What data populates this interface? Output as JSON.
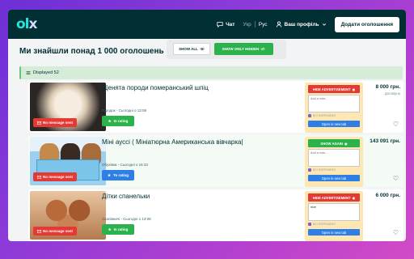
{
  "header": {
    "logo": "olx",
    "chat_label": "Чат",
    "lang_uk": "Укр",
    "lang_ru": "Рус",
    "profile_label": "Ваш профіль",
    "post_button": "Додати оголошення"
  },
  "main": {
    "title": "Ми знайшли понад 1 000 оголошень",
    "show_all": "SHOW ALL",
    "show_all_icon": "eye-icon",
    "show_hidden": "SHOW ONLY HIDDEN",
    "displayed": "Displayed 52"
  },
  "listings": [
    {
      "title": "Щенята породи померанський шпіц",
      "meta": "Городок - Сьогодні о 13:08",
      "badge": "No message sent",
      "rating_label": "In rating",
      "action": "HIDE ADVERTISEMENT",
      "note_value": "",
      "note_placeholder": "Add a note...",
      "save_label": "ВСІ ЗБЕРЕЖЕНО",
      "open_label": "Open in new tab",
      "price": "8 000 грн.",
      "price_sub": "Договірна"
    },
    {
      "title": "Міні ауссі ( Мініатюрна Американська вівчарка|",
      "meta": "Обухівка - Сьогодні о 16:33",
      "badge": "No message sent",
      "rating_label": "To rating",
      "action": "SHOW AGAIN",
      "note_value": "",
      "note_placeholder": "Add a note...",
      "save_label": "ВСІ ЗБЕРЕЖЕНО",
      "open_label": "Open in new tab",
      "price": "143 091 грн.",
      "price_sub": ""
    },
    {
      "title": "Дітки спанельки",
      "meta": "Скалівничі - Сьогодні о 13:08",
      "badge": "No message sent",
      "rating_label": "In rating",
      "action": "HIDE ADVERTISEMENT",
      "note_value": "nice",
      "note_placeholder": "Add a note...",
      "save_label": "ВСІ ЗБЕРЕЖЕНО",
      "open_label": "Open in new tab",
      "price": "6 000 грн.",
      "price_sub": ""
    }
  ],
  "colors": {
    "header_bg": "#002f34",
    "logo": "#23e5db",
    "green": "#2bb24c",
    "red": "#e53935",
    "blue": "#2d7fe6",
    "panel": "#ffe7b3"
  }
}
